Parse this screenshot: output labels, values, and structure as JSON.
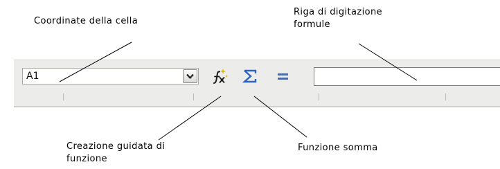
{
  "callouts": {
    "cell_coordinates": "Coordinate della cella",
    "formula_input_line_1": "Riga di digitazione",
    "formula_input_line_2": "formule",
    "function_wizard_line_1": "Creazione guidata di",
    "function_wizard_line_2": "funzione",
    "sum_function": "Funzione somma"
  },
  "toolbar": {
    "name_box_value": "A1",
    "dropdown_icon": "chevron-down-icon",
    "function_wizard_icon": "fx-wand-icon",
    "sum_icon": "sigma-icon",
    "equals_icon": "equals-icon",
    "formula_value": ""
  },
  "colors": {
    "toolbar_bg": "#ececea",
    "sum_icon": "#2b63c6",
    "wizard_star": "#e6b800"
  }
}
